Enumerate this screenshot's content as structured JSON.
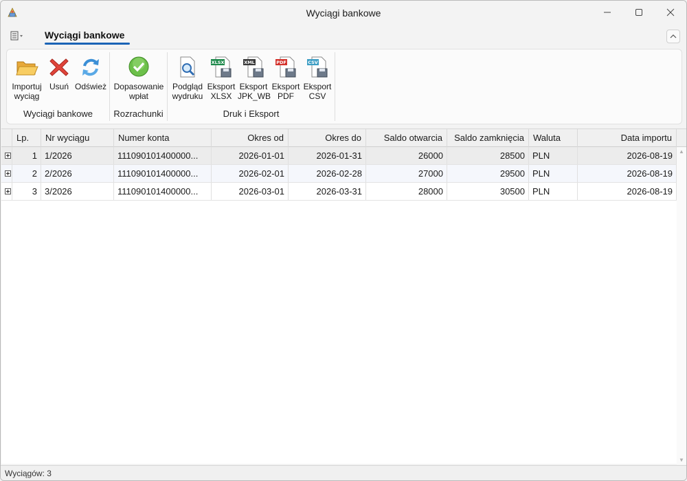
{
  "window": {
    "title": "Wyciągi bankowe"
  },
  "ribbon": {
    "active_tab": "Wyciągi bankowe",
    "groups": [
      {
        "label": "Wyciągi bankowe",
        "buttons": [
          {
            "line1": "Importuj",
            "line2": "wyciąg",
            "icon": "folder-open-icon"
          },
          {
            "line1": "Usuń",
            "line2": "",
            "icon": "delete-x-icon"
          },
          {
            "line1": "Odśwież",
            "line2": "",
            "icon": "refresh-icon"
          }
        ]
      },
      {
        "label": "Rozrachunki",
        "buttons": [
          {
            "line1": "Dopasowanie",
            "line2": "wpłat",
            "icon": "check-circle-icon"
          }
        ]
      },
      {
        "label": "Druk i Eksport",
        "buttons": [
          {
            "line1": "Podgląd",
            "line2": "wydruku",
            "icon": "print-preview-icon"
          },
          {
            "line1": "Eksport",
            "line2": "XLSX",
            "icon": "export-xlsx-icon",
            "badge": "XLSX"
          },
          {
            "line1": "Eksport",
            "line2": "JPK_WB",
            "icon": "export-xml-icon",
            "badge": "XML"
          },
          {
            "line1": "Eksport",
            "line2": "PDF",
            "icon": "export-pdf-icon",
            "badge": "PDF"
          },
          {
            "line1": "Eksport",
            "line2": "CSV",
            "icon": "export-csv-icon",
            "badge": "CSV"
          }
        ]
      }
    ]
  },
  "grid": {
    "columns": [
      "Lp.",
      "Nr wyciągu",
      "Numer konta",
      "Okres od",
      "Okres do",
      "Saldo otwarcia",
      "Saldo zamknięcia",
      "Waluta",
      "Data importu"
    ],
    "rows": [
      {
        "lp": "1",
        "nr": "1/2026",
        "konto": "111090101400000...",
        "od": "2026-01-01",
        "do": "2026-01-31",
        "saldo_otw": "26000",
        "saldo_zam": "28500",
        "waluta": "PLN",
        "data": "2026-08-19"
      },
      {
        "lp": "2",
        "nr": "2/2026",
        "konto": "111090101400000...",
        "od": "2026-02-01",
        "do": "2026-02-28",
        "saldo_otw": "27000",
        "saldo_zam": "29500",
        "waluta": "PLN",
        "data": "2026-08-19"
      },
      {
        "lp": "3",
        "nr": "3/2026",
        "konto": "111090101400000...",
        "od": "2026-03-01",
        "do": "2026-03-31",
        "saldo_otw": "28000",
        "saldo_zam": "30500",
        "waluta": "PLN",
        "data": "2026-08-19"
      }
    ]
  },
  "status": {
    "text": "Wyciągów: 3"
  },
  "colors": {
    "accent": "#1a63b6",
    "selected_row": "#ececec",
    "alt_row": "#f5f7fc"
  }
}
